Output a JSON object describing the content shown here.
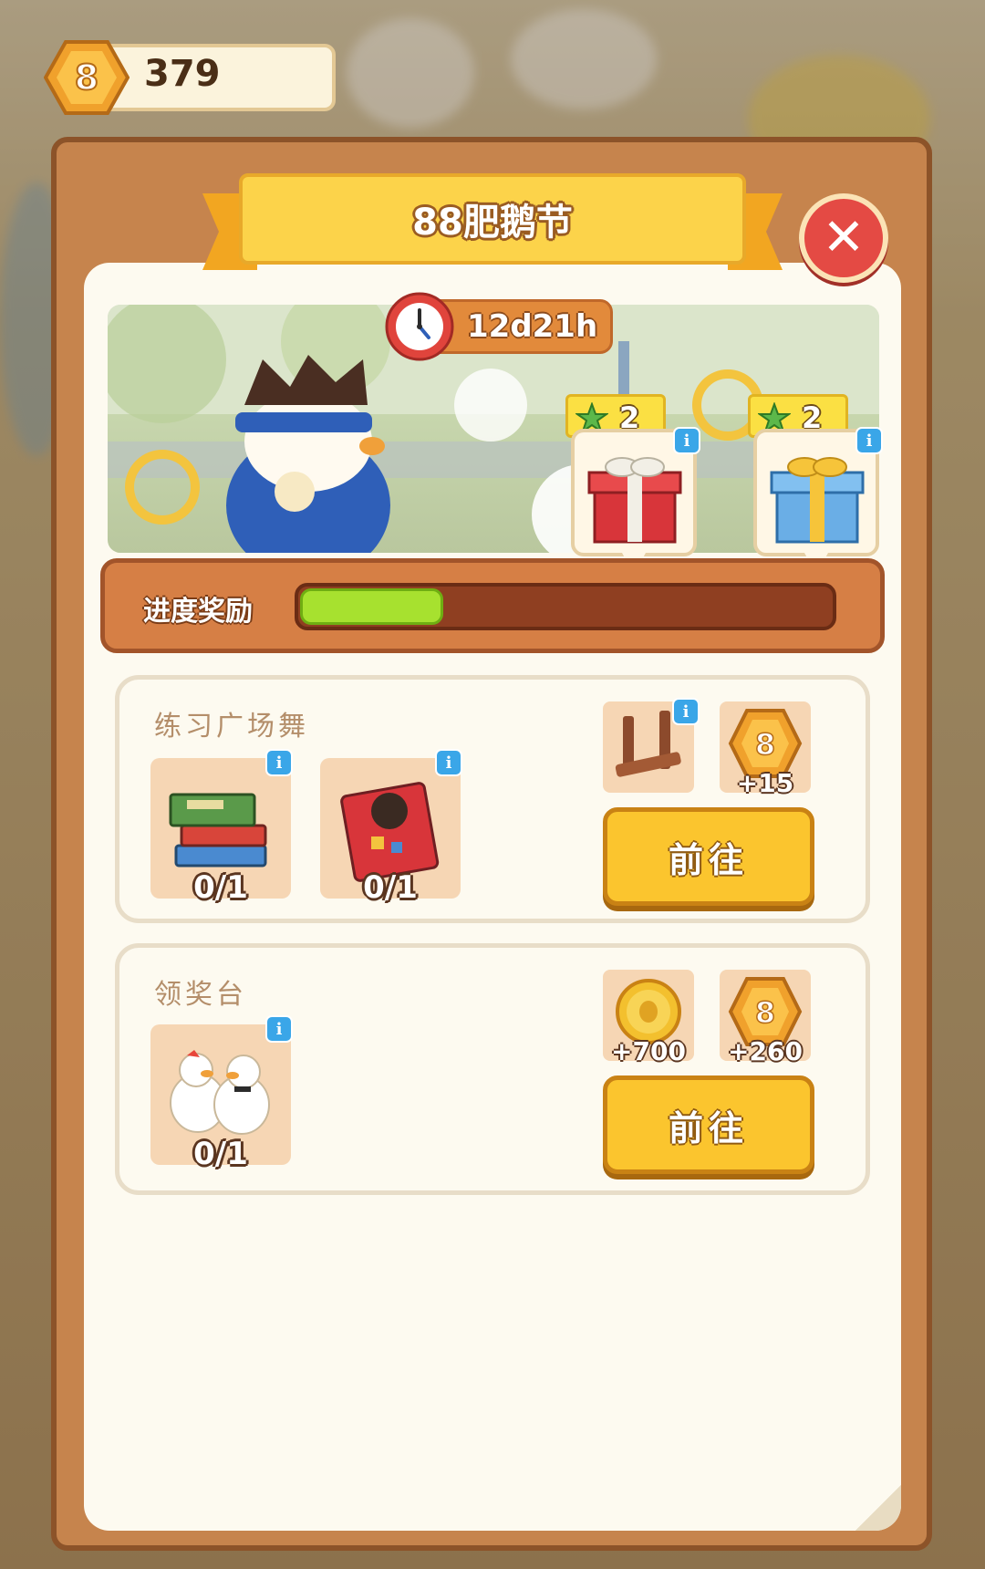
{
  "currency": {
    "amount": "379",
    "icon": "hex-coin-icon"
  },
  "event": {
    "title": "88肥鹅节",
    "time_left": "12d21h"
  },
  "milestones": [
    {
      "stars": "2",
      "reward": "red-gift-box-icon"
    },
    {
      "stars": "2",
      "reward": "blue-gift-box-icon"
    }
  ],
  "progress": {
    "label": "进度奖励",
    "fraction": 0.27
  },
  "tasks": [
    {
      "name": "练习广场舞",
      "requirements": [
        {
          "item": "book-stack-icon",
          "count": "0/1"
        },
        {
          "item": "red-book-icon",
          "count": "0/1"
        }
      ],
      "rewards": [
        {
          "item": "wooden-stand-icon",
          "amount": ""
        },
        {
          "item": "hex-coin-icon",
          "amount": "+15"
        }
      ],
      "button": "前往"
    },
    {
      "name": "领奖台",
      "requirements": [
        {
          "item": "goose-pair-icon",
          "count": "0/1"
        }
      ],
      "rewards": [
        {
          "item": "gold-coin-icon",
          "amount": "+700"
        },
        {
          "item": "hex-coin-icon",
          "amount": "+260"
        }
      ],
      "button": "前往"
    }
  ],
  "info_glyph": "i",
  "close_glyph": "✕",
  "colors": {
    "panel": "#c6844d",
    "accent_yellow": "#fbc52e",
    "progress_fill": "#a7e12f",
    "info_blue": "#3aa6e8"
  }
}
